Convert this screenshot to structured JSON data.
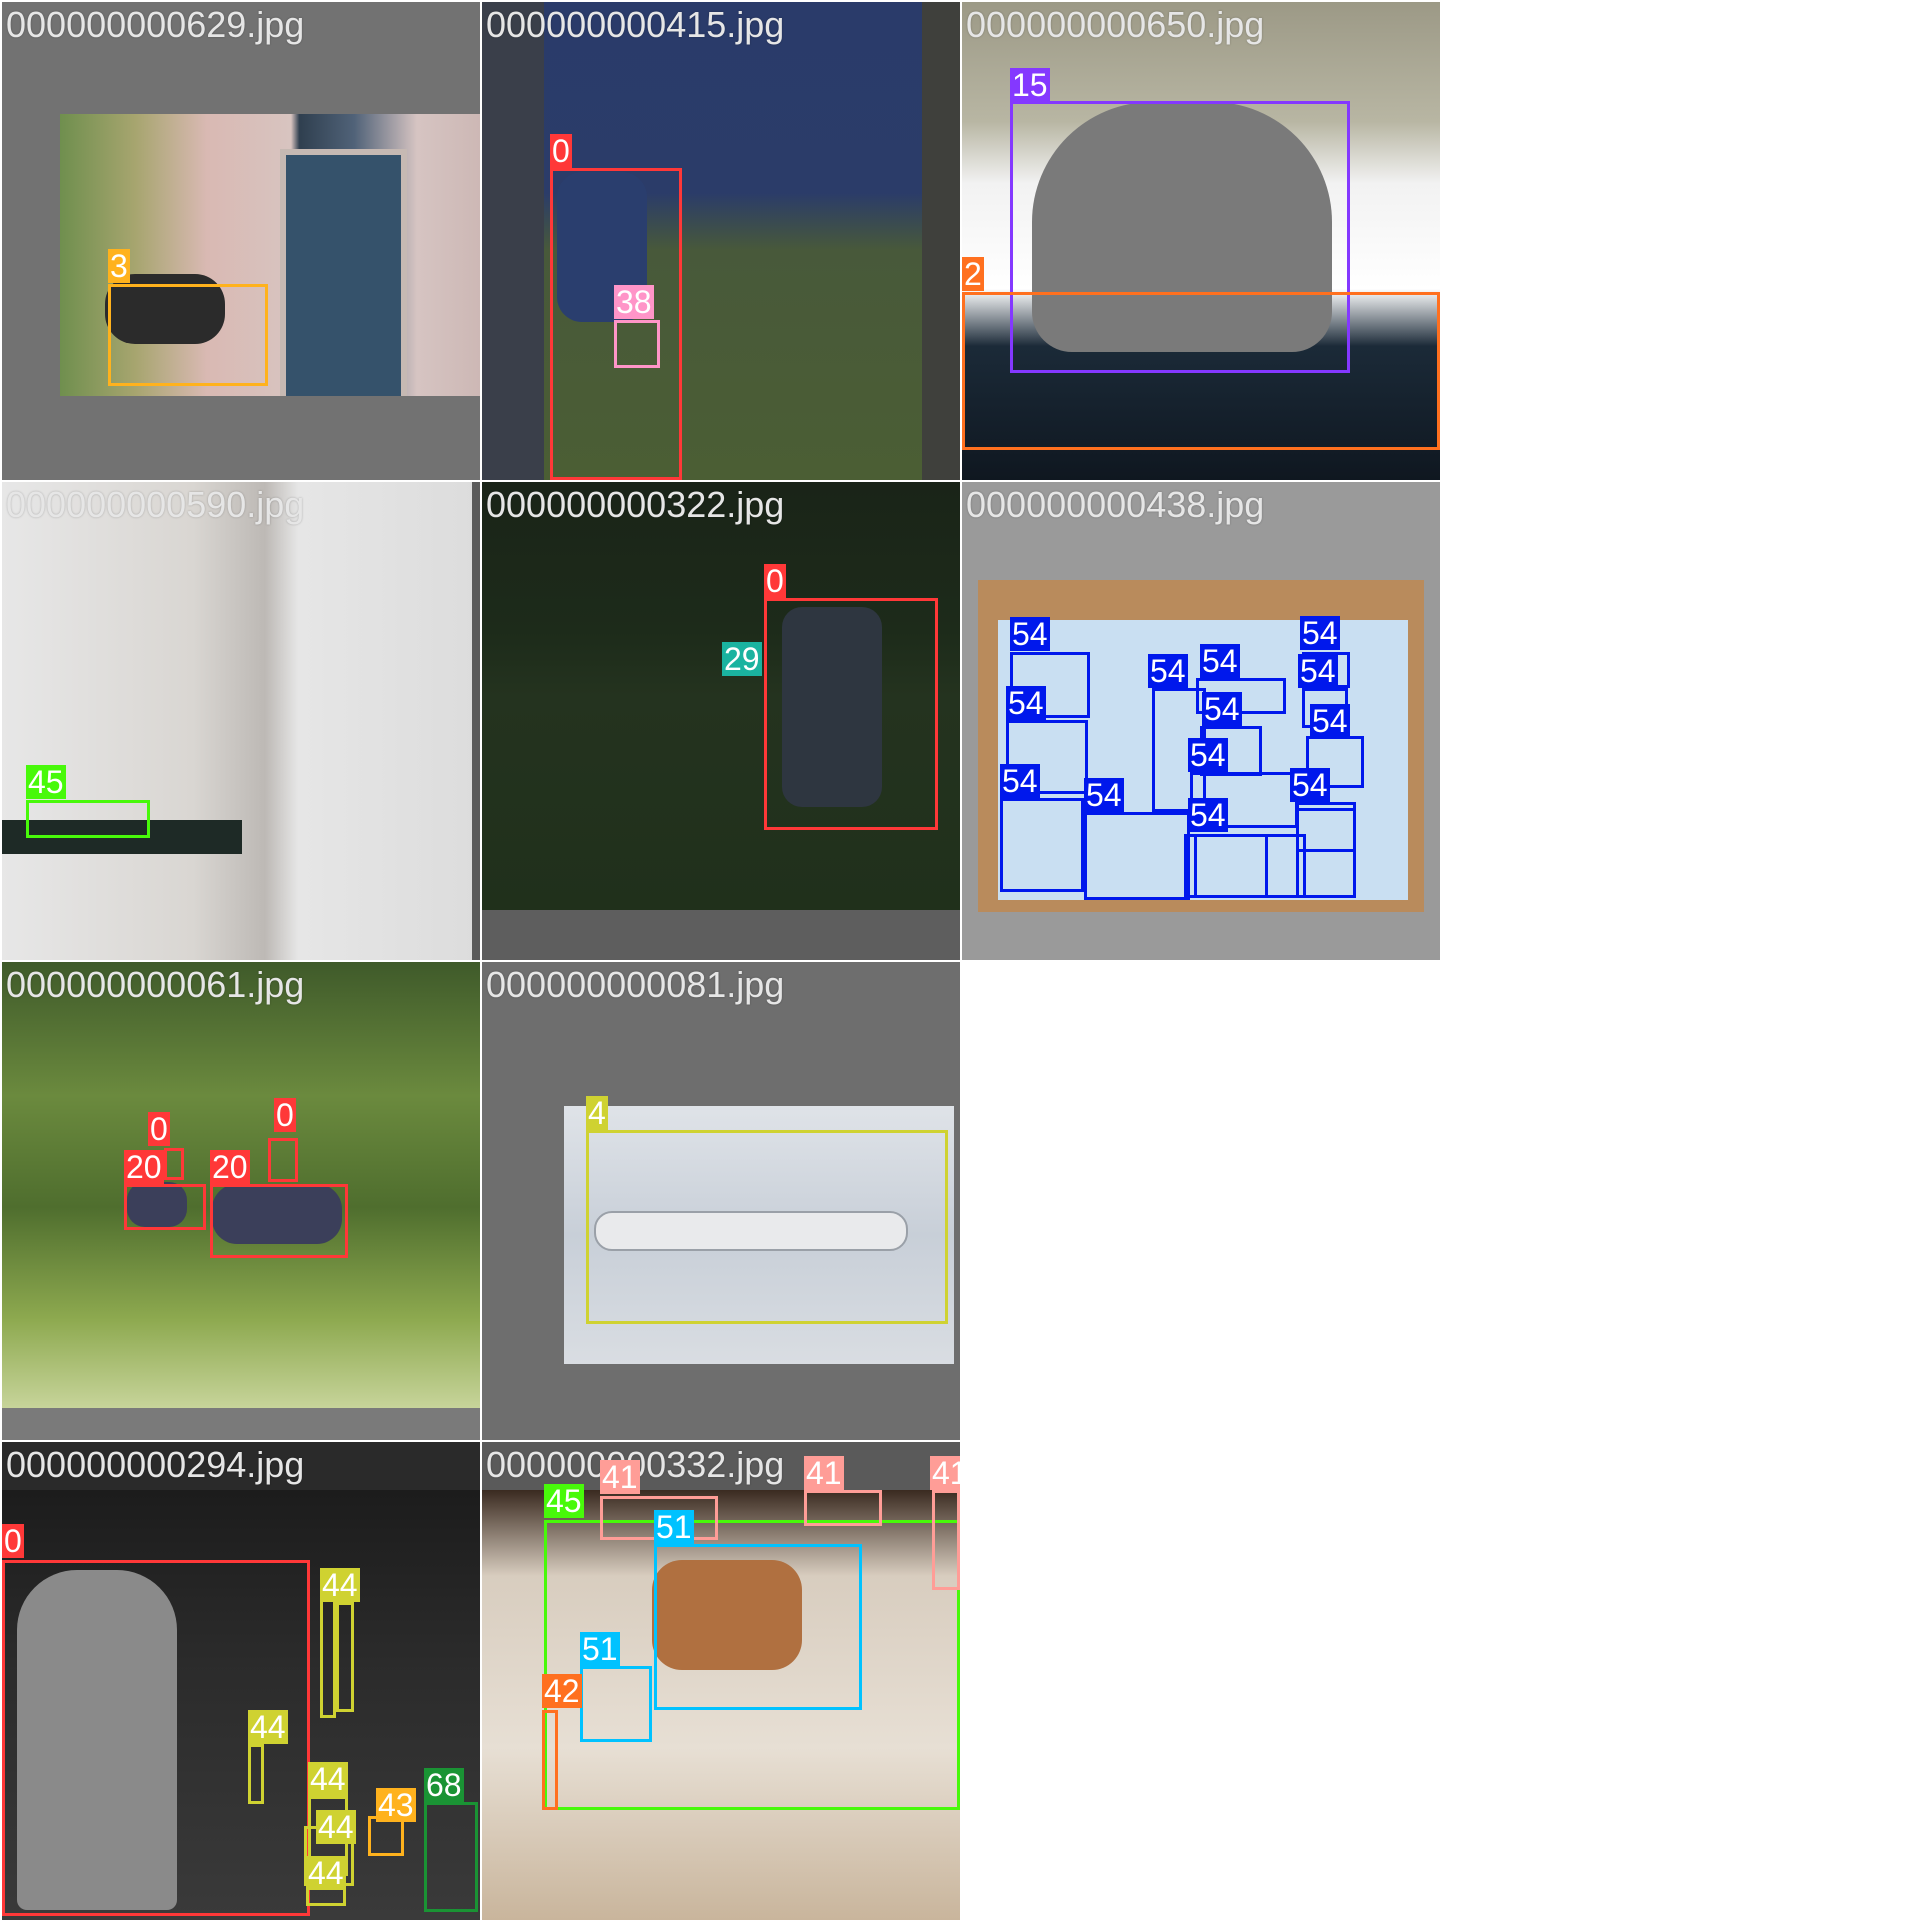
{
  "mosaic": {
    "tiles": [
      {
        "filename": "000000000629.jpg",
        "labels": [
          "3"
        ]
      },
      {
        "filename": "000000000415.jpg",
        "labels": [
          "0",
          "38"
        ]
      },
      {
        "filename": "000000000650.jpg",
        "labels": [
          "15",
          "2"
        ]
      },
      {
        "filename": "000000000590.jpg",
        "labels": [
          "45"
        ]
      },
      {
        "filename": "000000000322.jpg",
        "labels": [
          "0",
          "29"
        ]
      },
      {
        "filename": "000000000438.jpg",
        "labels": [
          "54",
          "54",
          "54",
          "54",
          "54",
          "54",
          "54",
          "54",
          "54",
          "54",
          "54",
          "54",
          "54",
          "54"
        ]
      },
      {
        "filename": "000000000061.jpg",
        "labels": [
          "0",
          "0",
          "20",
          "20"
        ]
      },
      {
        "filename": "000000000081.jpg",
        "labels": [
          "4"
        ]
      },
      {
        "filename": "000000000294.jpg",
        "labels": [
          "0",
          "44",
          "44",
          "44",
          "44",
          "44",
          "68",
          "43"
        ]
      },
      {
        "filename": "000000000332.jpg",
        "labels": [
          "45",
          "41",
          "41",
          "41",
          "51",
          "51",
          "42"
        ]
      }
    ]
  },
  "colors": {
    "class_0": "#ff3838",
    "class_2": "#ff701f",
    "class_3": "#ffb21d",
    "class_4": "#cfd231",
    "class_15": "#8438ff",
    "class_20": "#ff3838",
    "class_29": "#1ab3a0",
    "class_38": "#ff95c8",
    "class_41": "#ff9d97",
    "class_42": "#ff701f",
    "class_43": "#ffb21d",
    "class_44": "#cfd231",
    "class_45": "#48f90a",
    "class_51": "#00c2ff",
    "class_54": "#0018ec",
    "class_68": "#1a9334"
  }
}
